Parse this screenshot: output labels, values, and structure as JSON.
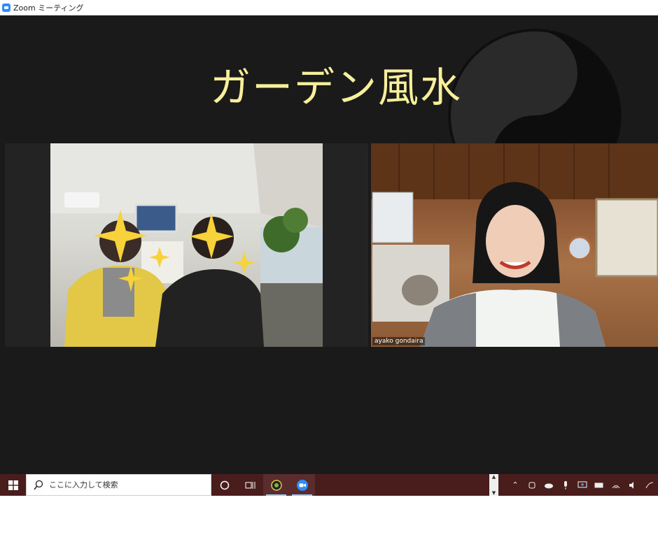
{
  "window": {
    "title": "Zoom ミーティング"
  },
  "slide": {
    "title": "ガーデン風水"
  },
  "participants": [
    {
      "name": ""
    },
    {
      "name": "ayako gondaira"
    }
  ],
  "taskbar": {
    "search_placeholder": "ここに入力して検索"
  },
  "icons": {
    "start": "windows-start-icon",
    "search": "search-icon",
    "task_view": "task-view-icon",
    "cortana": "cortana-circle-icon",
    "zoom": "zoom-icon",
    "chrome_app": "app-icon"
  },
  "colors": {
    "title_text": "#f7ef9a",
    "meeting_bg": "#1a1a1a",
    "taskbar_bg": "#4a1d1d",
    "zoom_blue": "#2D8CFF"
  }
}
